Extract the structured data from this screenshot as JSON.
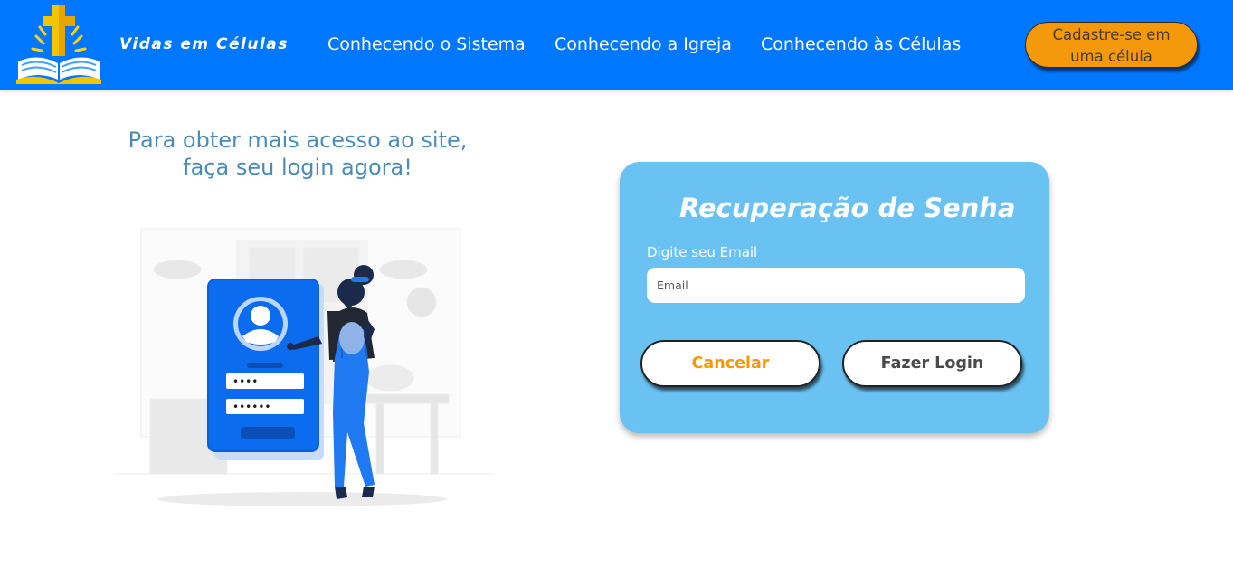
{
  "header": {
    "brand": "Vidas em Células",
    "nav": [
      {
        "label": "Conhecendo o Sistema"
      },
      {
        "label": "Conhecendo a Igreja"
      },
      {
        "label": "Conhecendo às Células"
      }
    ],
    "cta_line1": "Cadastre-se em",
    "cta_line2": "uma célula"
  },
  "main": {
    "headline_line1": "Para obter mais acesso ao site,",
    "headline_line2": "faça seu login agora!"
  },
  "recovery_card": {
    "title": "Recuperação de Senha",
    "email_label": "Digite seu Email",
    "email_placeholder": "Email",
    "email_value": "",
    "cancel_label": "Cancelar",
    "login_label": "Fazer Login"
  },
  "illustration": {
    "username_mask": "••••",
    "password_mask": "••••••"
  },
  "colors": {
    "navbar": "#0077ff",
    "cta": "#f5990c",
    "card": "#69c2f2",
    "headline": "#4a8cb8",
    "cancel_text": "#f5990c"
  },
  "icons": {
    "logo": "cross-bible-logo-icon",
    "illustration": "login-phone-illustration"
  }
}
